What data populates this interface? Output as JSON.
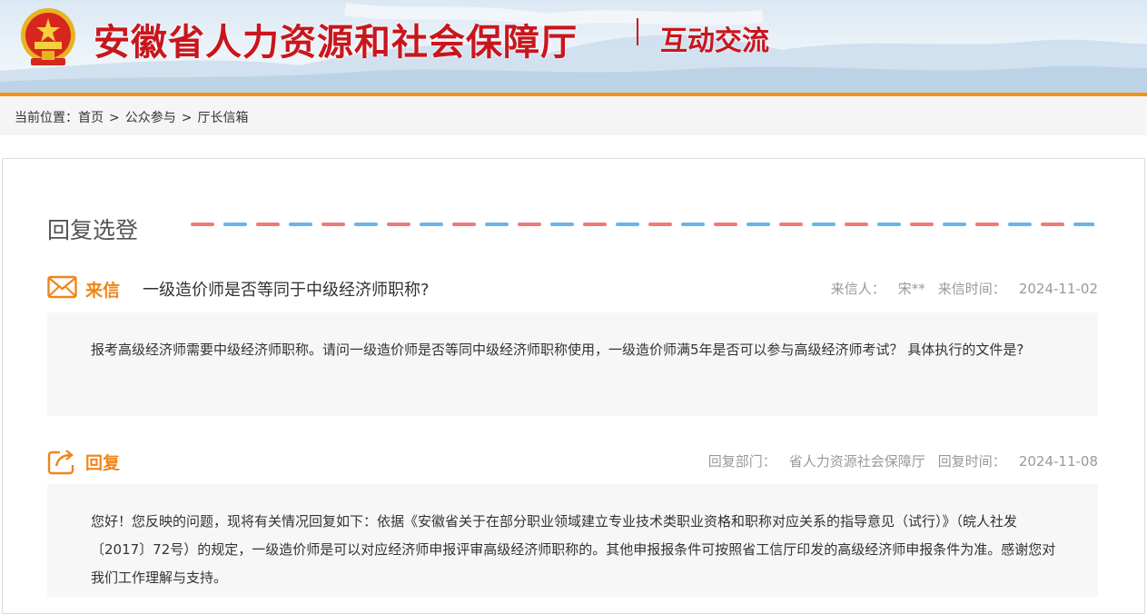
{
  "header": {
    "site_title": "安徽省人力资源和社会保障厅",
    "section_title": "互动交流",
    "colors": {
      "brand_red": "#c8161d",
      "accent_orange": "#f39214"
    }
  },
  "breadcrumb": {
    "prefix": "当前位置：",
    "items": [
      "首页",
      "公众参与",
      "厅长信箱"
    ],
    "separator": ">"
  },
  "main": {
    "heading": "回复选登",
    "letter": {
      "tag": "来信",
      "icon": "envelope-icon",
      "subject": "一级造价师是否等同于中级经济师职称?",
      "sender_label": "来信人：",
      "sender": "宋**",
      "date_label": "来信时间：",
      "date": "2024-11-02",
      "body": "报考高级经济师需要中级经济师职称。请问一级造价师是否等同中级经济师职称使用，一级造价师满5年是否可以参与高级经济师考试？ 具体执行的文件是?"
    },
    "reply": {
      "tag": "回复",
      "icon": "share-reply-icon",
      "dept_label": "回复部门：",
      "dept": "省人力资源社会保障厅",
      "date_label": "回复时间：",
      "date": "2024-11-08",
      "body": "您好！您反映的问题，现将有关情况回复如下：依据《安徽省关于在部分职业领域建立专业技术类职业资格和职称对应关系的指导意见（试行）》（皖人社发〔2017〕72号）的规定，一级造价师是可以对应经济师申报评审高级经济师职称的。其他申报报条件可按照省工信厅印发的高级经济师申报条件为准。感谢您对我们工作理解与支持。"
    }
  }
}
